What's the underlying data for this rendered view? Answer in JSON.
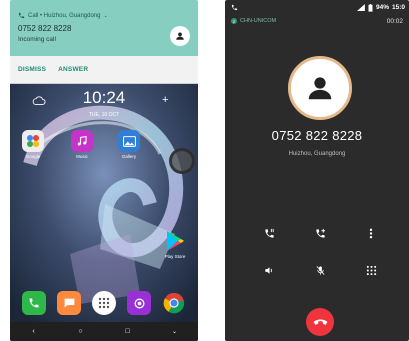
{
  "notification": {
    "header": "Call • Huizhou, Guangdong",
    "number": "0752 822 8228",
    "subtitle": "Incoming call",
    "dismiss_label": "DISMISS",
    "answer_label": "ANSWER"
  },
  "lockscreen": {
    "time": "10:24",
    "date": "TUE, 10 OCT"
  },
  "apps": [
    {
      "label": "Google",
      "icon": "google-folder-icon"
    },
    {
      "label": "Music",
      "icon": "music-icon"
    },
    {
      "label": "Gallery",
      "icon": "gallery-icon"
    },
    {
      "label": "Play Store",
      "icon": "play-store-icon"
    }
  ],
  "dock": [
    {
      "icon": "phone-icon"
    },
    {
      "icon": "messages-icon"
    },
    {
      "icon": "app-drawer-icon"
    },
    {
      "icon": "camera-icon"
    },
    {
      "icon": "chrome-icon"
    }
  ],
  "call_screen": {
    "status_battery": "94%",
    "status_time": "15:0",
    "carrier_sim": "2",
    "carrier": "CHN-UNICOM",
    "timer": "00:02",
    "number": "0752 822 8228",
    "location": "Huizhou, Guangdong"
  },
  "colors": {
    "notification_bg": "#86cfc0",
    "accent": "#1f8a72",
    "hangup": "#f0343e",
    "call_bg": "#2b2b2b"
  }
}
